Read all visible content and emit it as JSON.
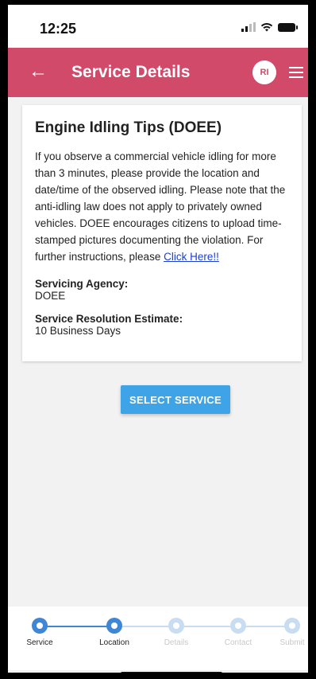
{
  "status_bar": {
    "time": "12:25"
  },
  "header": {
    "back_icon": "←",
    "title": "Service Details",
    "avatar_initials": "RI",
    "accent_color": "#d14a6a"
  },
  "card": {
    "title": "Engine Idling Tips (DOEE)",
    "description": "If you observe a commercial vehicle idling for more than 3 minutes, please provide the location and date/time of the observed idling. Please note that the anti-idling law does not apply to privately owned vehicles. DOEE encourages citizens to upload time-stamped pictures documenting the violation. For further instructions, please ",
    "link_text": "Click Here!!",
    "servicing_agency_label": "Servicing Agency:",
    "servicing_agency_value": "DOEE",
    "resolution_label": "Service Resolution Estimate:",
    "resolution_value": "10 Business Days"
  },
  "actions": {
    "select_service_label": "SELECT SERVICE"
  },
  "stepper": {
    "steps": [
      {
        "label": "Service",
        "active": true
      },
      {
        "label": "Location",
        "active": true
      },
      {
        "label": "Details",
        "active": false
      },
      {
        "label": "Contact",
        "active": false
      },
      {
        "label": "Submit",
        "active": false
      }
    ]
  }
}
